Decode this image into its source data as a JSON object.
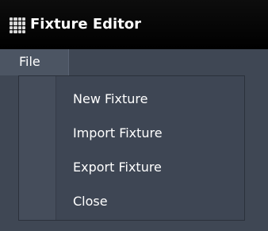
{
  "window": {
    "title": "Fixture Editor",
    "icon": "grid-icon"
  },
  "menubar": {
    "file_label": "File"
  },
  "file_menu": {
    "items": [
      {
        "label": "New Fixture"
      },
      {
        "label": "Import Fixture"
      },
      {
        "label": "Export Fixture"
      },
      {
        "label": "Close"
      }
    ]
  },
  "colors": {
    "background": "#3f4754",
    "titlebar": "#000000",
    "text": "#ffffff"
  }
}
